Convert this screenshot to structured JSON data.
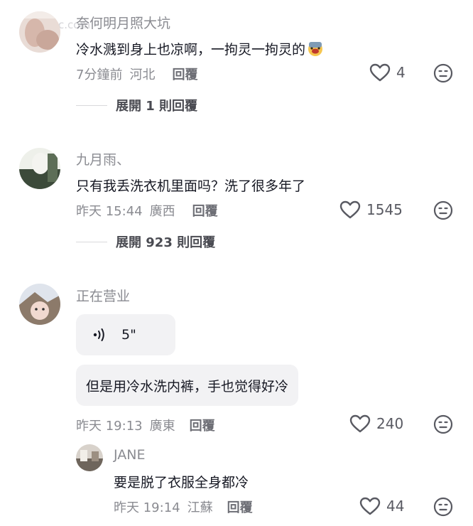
{
  "watermark": "c.com",
  "comments": [
    {
      "username": "奈何明月照大坑",
      "text": "冷水溅到身上也凉啊，一拘灵一拘灵的",
      "emoji_icon": "crying-face-emoji",
      "time": "7分鐘前",
      "location": "河北",
      "reply_label": "回覆",
      "likes": "4",
      "expand_label": "展開 1 則回覆"
    },
    {
      "username": "九月雨、",
      "text": "只有我丢洗衣机里面吗？洗了很多年了",
      "time": "昨天 15:44",
      "location": "廣西",
      "reply_label": "回覆",
      "likes": "1545",
      "expand_label": "展開 923 則回覆"
    },
    {
      "username": "正在营业",
      "voice_duration": "5\"",
      "text": "但是用冷水洗内裤，手也觉得好冷",
      "time": "昨天 19:13",
      "location": "廣東",
      "reply_label": "回覆",
      "likes": "240"
    }
  ],
  "reply": {
    "username": "JANE",
    "text": "要是脱了衣服全身都冷",
    "time": "昨天 19:14",
    "location": "江蘇",
    "reply_label": "回覆",
    "likes": "44"
  },
  "colors": {
    "text_primary": "#161823",
    "text_secondary": "#8a8b91",
    "bubble_bg": "#f2f2f4"
  }
}
